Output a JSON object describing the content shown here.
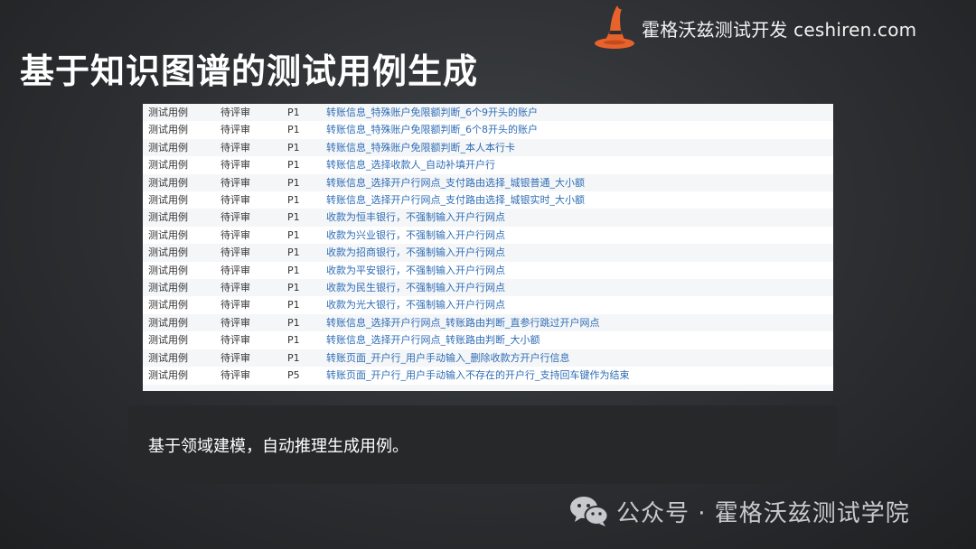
{
  "brand": {
    "text": "霍格沃兹测试开发 ceshiren.com"
  },
  "page": {
    "title": "基于知识图谱的测试用例生成"
  },
  "table": {
    "rows": [
      {
        "type": "测试用例",
        "status": "待评审",
        "priority": "P1",
        "title": "转账信息_特殊账户免限额判断_6个9开头的账户"
      },
      {
        "type": "测试用例",
        "status": "待评审",
        "priority": "P1",
        "title": "转账信息_特殊账户免限额判断_6个8开头的账户"
      },
      {
        "type": "测试用例",
        "status": "待评审",
        "priority": "P1",
        "title": "转账信息_特殊账户免限额判断_本人本行卡"
      },
      {
        "type": "测试用例",
        "status": "待评审",
        "priority": "P1",
        "title": "转账信息_选择收款人_自动补填开户行"
      },
      {
        "type": "测试用例",
        "status": "待评审",
        "priority": "P1",
        "title": "转账信息_选择开户行网点_支付路由选择_城银普通_大小额"
      },
      {
        "type": "测试用例",
        "status": "待评审",
        "priority": "P1",
        "title": "转账信息_选择开户行网点_支付路由选择_城银实时_大小额"
      },
      {
        "type": "测试用例",
        "status": "待评审",
        "priority": "P1",
        "title": "收款为恒丰银行，不强制输入开户行网点"
      },
      {
        "type": "测试用例",
        "status": "待评审",
        "priority": "P1",
        "title": "收款为兴业银行，不强制输入开户行网点"
      },
      {
        "type": "测试用例",
        "status": "待评审",
        "priority": "P1",
        "title": "收款为招商银行，不强制输入开户行网点"
      },
      {
        "type": "测试用例",
        "status": "待评审",
        "priority": "P1",
        "title": "收款为平安银行，不强制输入开户行网点"
      },
      {
        "type": "测试用例",
        "status": "待评审",
        "priority": "P1",
        "title": "收款为民生银行，不强制输入开户行网点"
      },
      {
        "type": "测试用例",
        "status": "待评审",
        "priority": "P1",
        "title": "收款为光大银行，不强制输入开户行网点"
      },
      {
        "type": "测试用例",
        "status": "待评审",
        "priority": "P1",
        "title": "转账信息_选择开户行网点_转账路由判断_直参行跳过开户网点"
      },
      {
        "type": "测试用例",
        "status": "待评审",
        "priority": "P1",
        "title": "转账信息_选择开户行网点_转账路由判断_大小额"
      },
      {
        "type": "测试用例",
        "status": "待评审",
        "priority": "P1",
        "title": "转账页面_开户行_用户手动输入_删除收款方开户行信息"
      },
      {
        "type": "测试用例",
        "status": "待评审",
        "priority": "P5",
        "title": "转账页面_开户行_用户手动输入不存在的开户行_支持回车键作为结束"
      }
    ]
  },
  "caption": {
    "text": "基于领域建模，自动推理生成用例。"
  },
  "watermark": {
    "text": "公众号 · 霍格沃兹测试学院"
  },
  "colors": {
    "background": "#2c2e31",
    "title_text": "#ffffff",
    "link_blue": "#2f6db5",
    "brand_orange": "#e8622c",
    "caption_box": "#26282a",
    "watermark_gray": "#c7c9cc"
  },
  "icons": {
    "brand": "wizard-hat-icon",
    "watermark": "wechat-icon"
  }
}
